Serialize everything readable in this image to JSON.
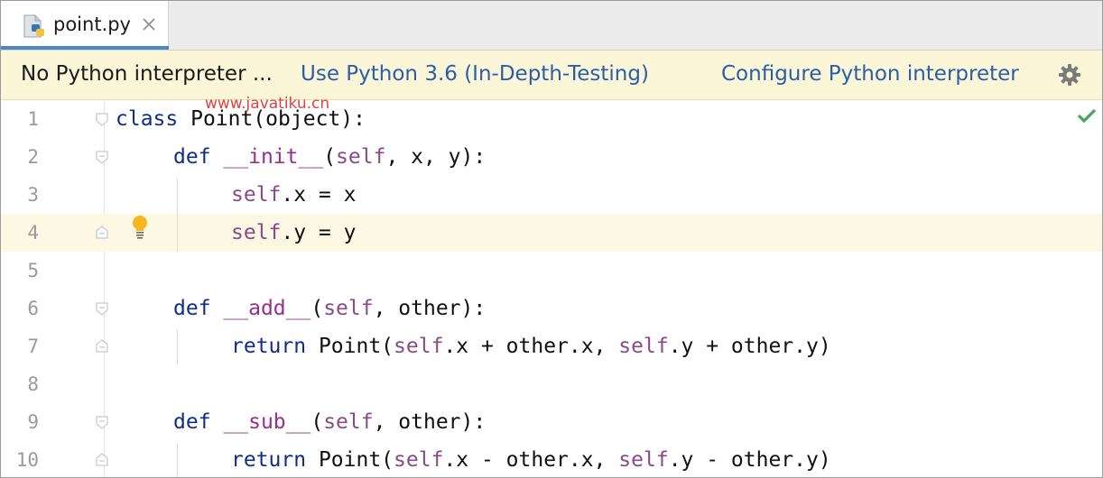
{
  "tab": {
    "label": "point.py",
    "icon": "python-file-icon"
  },
  "banner": {
    "message": "No Python interpreter ...",
    "link_use": "Use Python 3.6 (In-Depth-Testing)",
    "link_configure": "Configure Python interpreter",
    "icon": "gear-icon"
  },
  "watermark": "www.javatiku.cn",
  "editor": {
    "current_line": 4,
    "lines": [
      {
        "num": "1",
        "tokens": [
          {
            "t": "class",
            "k": "kw"
          },
          {
            "t": " Point(object):",
            "k": ""
          }
        ]
      },
      {
        "num": "2",
        "tokens": [
          {
            "t": "def",
            "k": "kw"
          },
          {
            "t": " ",
            "k": ""
          },
          {
            "t": "__init__",
            "k": "fn"
          },
          {
            "t": "(",
            "k": ""
          },
          {
            "t": "self",
            "k": "sf"
          },
          {
            "t": ", x, y):",
            "k": ""
          }
        ]
      },
      {
        "num": "3",
        "tokens": [
          {
            "t": "self",
            "k": "sf"
          },
          {
            "t": ".x = x",
            "k": ""
          }
        ]
      },
      {
        "num": "4",
        "tokens": [
          {
            "t": "self",
            "k": "sf"
          },
          {
            "t": ".y = y",
            "k": ""
          }
        ]
      },
      {
        "num": "5",
        "tokens": []
      },
      {
        "num": "6",
        "tokens": [
          {
            "t": "def",
            "k": "kw"
          },
          {
            "t": " ",
            "k": ""
          },
          {
            "t": "__add__",
            "k": "fn"
          },
          {
            "t": "(",
            "k": ""
          },
          {
            "t": "self",
            "k": "sf"
          },
          {
            "t": ", other):",
            "k": ""
          }
        ]
      },
      {
        "num": "7",
        "tokens": [
          {
            "t": "return",
            "k": "kw"
          },
          {
            "t": " Point(",
            "k": ""
          },
          {
            "t": "self",
            "k": "sf"
          },
          {
            "t": ".x + other.x, ",
            "k": ""
          },
          {
            "t": "self",
            "k": "sf"
          },
          {
            "t": ".y + other.y)",
            "k": ""
          }
        ]
      },
      {
        "num": "8",
        "tokens": []
      },
      {
        "num": "9",
        "tokens": [
          {
            "t": "def",
            "k": "kw"
          },
          {
            "t": " ",
            "k": ""
          },
          {
            "t": "__sub__",
            "k": "fn"
          },
          {
            "t": "(",
            "k": ""
          },
          {
            "t": "self",
            "k": "sf"
          },
          {
            "t": ", other):",
            "k": ""
          }
        ]
      },
      {
        "num": "10",
        "tokens": [
          {
            "t": "return",
            "k": "kw"
          },
          {
            "t": " Point(",
            "k": ""
          },
          {
            "t": "self",
            "k": "sf"
          },
          {
            "t": ".x - other.x, ",
            "k": ""
          },
          {
            "t": "self",
            "k": "sf"
          },
          {
            "t": ".y - other.y)",
            "k": ""
          }
        ]
      }
    ]
  },
  "colors": {
    "keyword": "#0f2d8c",
    "dunder": "#9a2e8f",
    "self": "#8a4a8a",
    "link": "#2b5ea8",
    "banner_bg": "#fbf6d8",
    "current_line_bg": "#fcf8e3"
  }
}
